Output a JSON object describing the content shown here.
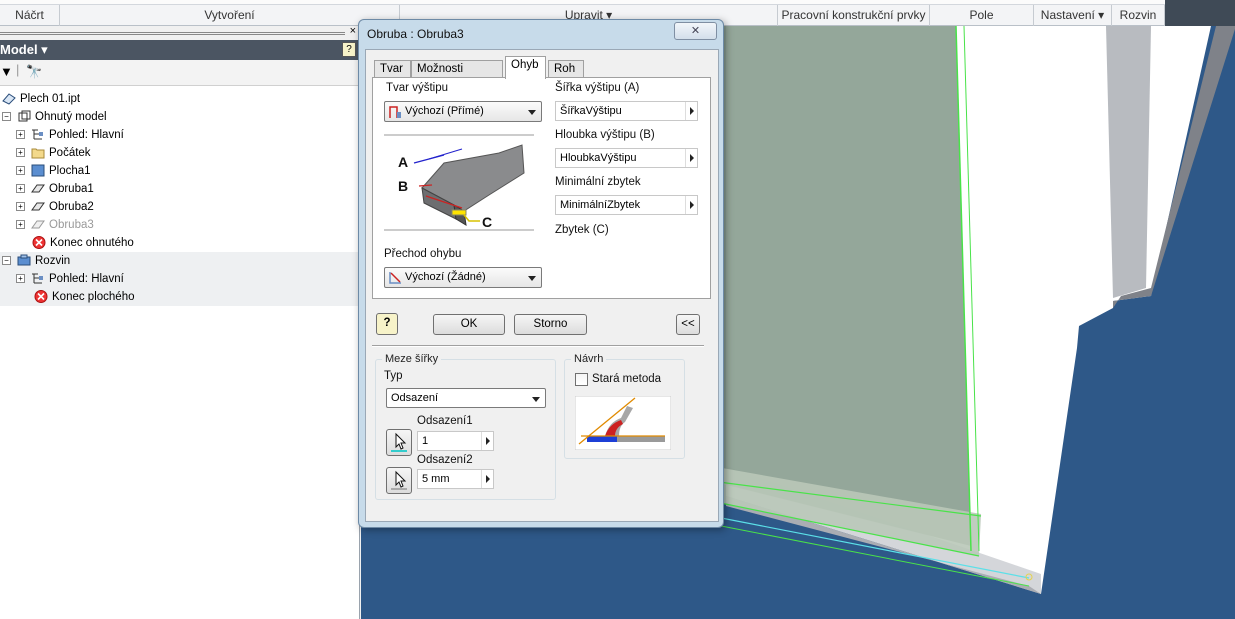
{
  "ribbon": {
    "panels": [
      "Náčrt",
      "Vytvoření",
      "Upravit ▾",
      "Pracovní konstrukční prvky",
      "Pole",
      "Nastavení ▾",
      "Rozvin"
    ]
  },
  "browser": {
    "title": "Model ▾",
    "close_glyph": "×",
    "help_glyph": "?",
    "filter_glyph": "▼",
    "find_glyph": "🔭",
    "items": [
      {
        "label": "Plech 01.ipt"
      },
      {
        "label": "Ohnutý model"
      },
      {
        "label": "Pohled: Hlavní"
      },
      {
        "label": "Počátek"
      },
      {
        "label": "Plocha1"
      },
      {
        "label": "Obruba1"
      },
      {
        "label": "Obruba2"
      },
      {
        "label": "Obruba3"
      },
      {
        "label": "Konec ohnutého"
      },
      {
        "label": "Rozvin"
      },
      {
        "label": "Pohled: Hlavní"
      },
      {
        "label": "Konec plochého"
      }
    ]
  },
  "dialog": {
    "title": "Obruba : Obruba3",
    "close_glyph": "✕",
    "tabs": [
      "Tvar",
      "Možnosti rozvinu",
      "Ohyb",
      "Roh"
    ],
    "active_tab": "Ohyb",
    "relief_shape_label": "Tvar výštipu",
    "relief_shape_value": "Výchozí (Přímé)",
    "relief_width_label": "Šířka výštipu (A)",
    "relief_width_value": "ŠířkaVýštipu",
    "relief_depth_label": "Hloubka výštipu (B)",
    "relief_depth_value": "HloubkaVýštipu",
    "min_remnant_label": "Minimální zbytek",
    "min_remnant_value": "MinimálníZbytek",
    "remnant_label": "Zbytek (C)",
    "diagram_labels": [
      "A",
      "B",
      "C"
    ],
    "bend_transition_label": "Přechod ohybu",
    "bend_transition_value": "Výchozí (Žádné)",
    "help_glyph": "?",
    "ok_label": "OK",
    "cancel_label": "Storno",
    "more_label": "<<",
    "width_extents": {
      "title": "Meze šířky",
      "type_label": "Typ",
      "type_value": "Odsazení",
      "offset1_label": "Odsazení1",
      "offset1_value": "1",
      "offset2_label": "Odsazení2",
      "offset2_value": "5 mm"
    },
    "design": {
      "title": "Návrh",
      "old_method_label": "Stará metoda",
      "old_method_checked": false
    }
  }
}
